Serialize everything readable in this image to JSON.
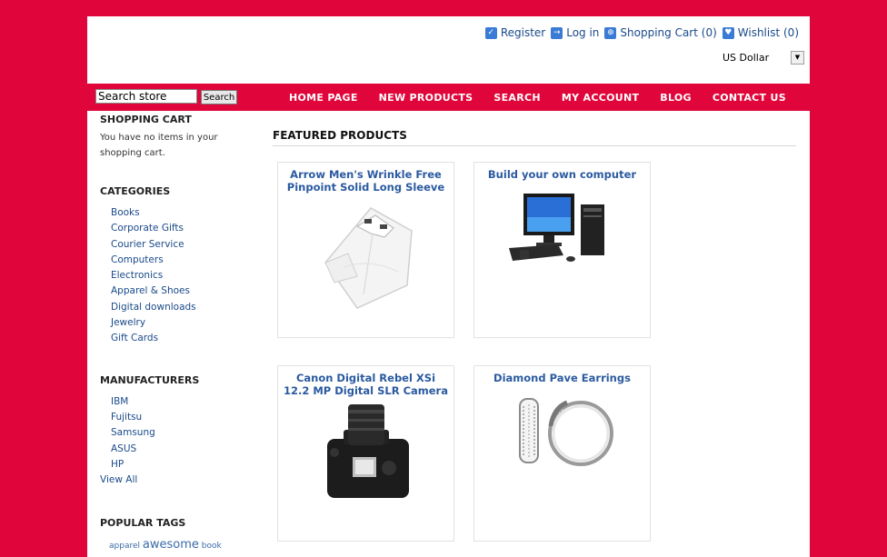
{
  "header": {
    "links": [
      {
        "label": "Register",
        "icon": "register-icon"
      },
      {
        "label": "Log in",
        "icon": "login-icon"
      },
      {
        "label": "Shopping Cart (0)",
        "icon": "cart-icon"
      },
      {
        "label": "Wishlist (0)",
        "icon": "wishlist-icon"
      }
    ],
    "currency": "US Dollar"
  },
  "search": {
    "value": "Search store",
    "button": "Search"
  },
  "nav": [
    "HOME PAGE",
    "NEW PRODUCTS",
    "SEARCH",
    "MY ACCOUNT",
    "BLOG",
    "CONTACT US"
  ],
  "sidebar": {
    "cart_title": "SHOPPING CART",
    "cart_text": "You have no items in your shopping cart.",
    "categories_title": "CATEGORIES",
    "categories": [
      "Books",
      "Corporate Gifts",
      "Courier Service",
      "Computers",
      "Electronics",
      "Apparel & Shoes",
      "Digital downloads",
      "Jewelry",
      "Gift Cards"
    ],
    "manufacturers_title": "MANUFACTURERS",
    "manufacturers": [
      "IBM",
      "Fujitsu",
      "Samsung",
      "ASUS",
      "HP"
    ],
    "view_all": "View All",
    "tags_title": "POPULAR TAGS",
    "tags": [
      "apparel",
      "awesome",
      "book"
    ]
  },
  "main": {
    "featured_title": "FEATURED PRODUCTS",
    "products": [
      {
        "name": "Arrow Men's Wrinkle Free Pinpoint Solid Long Sleeve",
        "image": "shirt-image"
      },
      {
        "name": "Build your own computer",
        "image": "computer-image"
      },
      {
        "name": "Canon Digital Rebel XSi 12.2 MP Digital SLR Camera",
        "image": "camera-image"
      },
      {
        "name": "Diamond Pave Earrings",
        "image": "earrings-image"
      }
    ]
  },
  "colors": {
    "brand": "#e0053a",
    "link": "#1a4a8a",
    "product_title": "#2a5aa0"
  }
}
